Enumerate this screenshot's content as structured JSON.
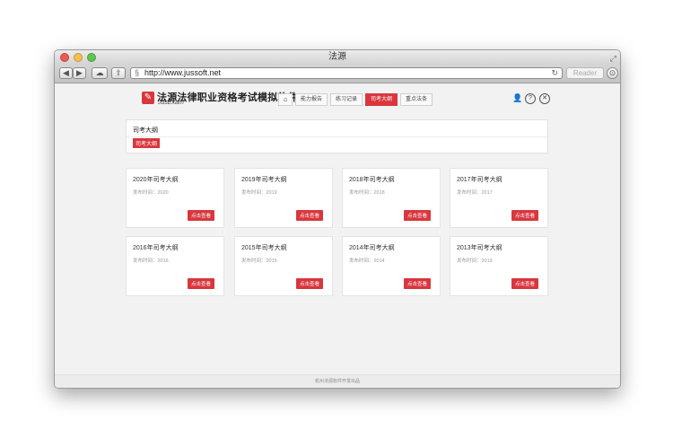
{
  "window": {
    "title": "法源",
    "fullscreen_glyph": "⤢"
  },
  "toolbar": {
    "back_glyph": "◀",
    "forward_glyph": "▶",
    "cloud_glyph": "☁",
    "share_glyph": "⇪",
    "url": "http://www.jussoft.net",
    "site_glyph": "§",
    "reload_glyph": "↻",
    "reader_label": "Reader",
    "download_glyph": "⊙"
  },
  "app": {
    "logo_glyph": "✎",
    "title": "法源法律职业资格考试模拟软件",
    "subtitle": "JusExam",
    "nav": {
      "home_glyph": "⌂",
      "items": [
        "能力报告",
        "练习记录",
        "司考大纲",
        "重点法条"
      ]
    },
    "header_icons": {
      "user": "👤",
      "help": "?",
      "close": "✕"
    }
  },
  "panel": {
    "title": "司考大纲",
    "tag": "司考大纲"
  },
  "cards": [
    {
      "title": "2020年司考大纲",
      "date": "发布时间：2020",
      "button": "点击查看"
    },
    {
      "title": "2019年司考大纲",
      "date": "发布时间：2019",
      "button": "点击查看"
    },
    {
      "title": "2018年司考大纲",
      "date": "发布时间：2018",
      "button": "点击查看"
    },
    {
      "title": "2017年司考大纲",
      "date": "发布时间：2017",
      "button": "点击查看"
    },
    {
      "title": "2016年司考大纲",
      "date": "发布时间：2016",
      "button": "点击查看"
    },
    {
      "title": "2015年司考大纲",
      "date": "发布时间：2015",
      "button": "点击查看"
    },
    {
      "title": "2014年司考大纲",
      "date": "发布时间：2014",
      "button": "点击查看"
    },
    {
      "title": "2013年司考大纲",
      "date": "发布时间：2013",
      "button": "点击查看"
    }
  ],
  "footer": {
    "text": "杭州法源软件开发出品"
  },
  "colors": {
    "accent": "#d9363e"
  }
}
